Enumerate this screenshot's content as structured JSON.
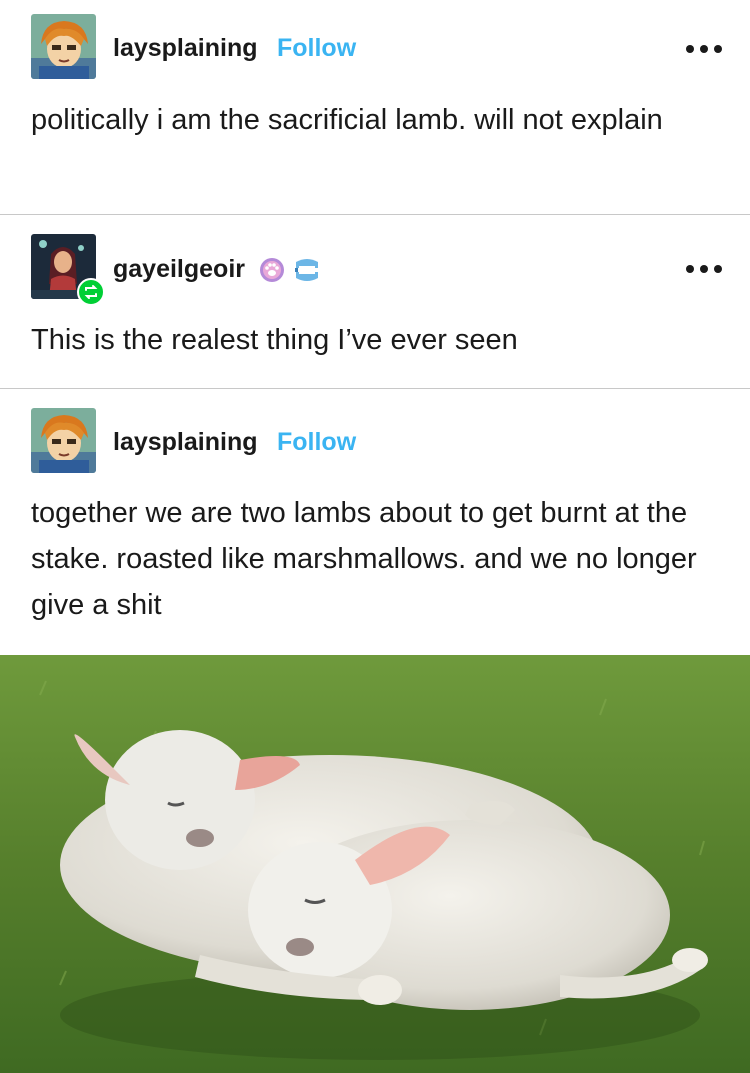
{
  "posts": [
    {
      "username": "laysplaining",
      "follow_label": "Follow",
      "text": "politically i am the sacrificial lamb. will not explain"
    },
    {
      "username": "gayeilgeoir",
      "badges": [
        "paw-badge-icon",
        "chattering-teeth-badge-icon"
      ],
      "text": "This is the realest thing I’ve ever seen"
    },
    {
      "username": "laysplaining",
      "follow_label": "Follow",
      "text": "together we are two lambs about to get burnt at the stake. roasted like marshmallows. and we no longer give a shit"
    }
  ],
  "image": {
    "subject": "two lambs lying on grass"
  },
  "colors": {
    "follow": "#3ab4f2",
    "reblog": "#00cf35",
    "text": "#1a1a1a"
  }
}
